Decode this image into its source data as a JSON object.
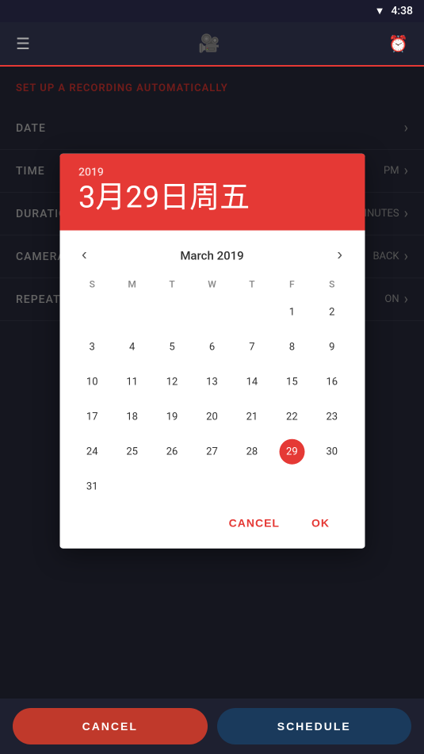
{
  "statusBar": {
    "time": "4:38"
  },
  "topNav": {
    "menuIcon": "☰",
    "cameraIcon": "📹",
    "alarmIcon": "⏰"
  },
  "page": {
    "title": "SET UP A RECORDING AUTOMATICALLY"
  },
  "settings": [
    {
      "label": "DATE",
      "value": "",
      "hasChevron": true
    },
    {
      "label": "TIME",
      "value": "PM",
      "hasChevron": true
    },
    {
      "label": "DURATION",
      "value": "MINUTES",
      "hasChevron": true
    },
    {
      "label": "CAMERA",
      "value": "BACK",
      "hasChevron": true
    },
    {
      "label": "REPEAT",
      "value": "ON",
      "hasChevron": true
    }
  ],
  "dialog": {
    "year": "2019",
    "dateDisplay": "3月29日周五",
    "monthLabel": "March 2019",
    "prevIcon": "‹",
    "nextIcon": "›",
    "dayHeaders": [
      "S",
      "M",
      "T",
      "W",
      "T",
      "F",
      "S"
    ],
    "weeks": [
      [
        "",
        "",
        "",
        "",
        "",
        "1",
        "2"
      ],
      [
        "3",
        "4",
        "5",
        "6",
        "7",
        "8",
        "9"
      ],
      [
        "10",
        "11",
        "12",
        "13",
        "14",
        "15",
        "16"
      ],
      [
        "17",
        "18",
        "19",
        "20",
        "21",
        "22",
        "23"
      ],
      [
        "24",
        "25",
        "26",
        "27",
        "28",
        "29",
        "30"
      ],
      [
        "31",
        "",
        "",
        "",
        "",
        "",
        ""
      ]
    ],
    "selectedDay": "29",
    "cancelLabel": "CANCEL",
    "okLabel": "OK"
  },
  "bottomBar": {
    "cancelLabel": "CANCEL",
    "scheduleLabel": "SCHEDULE"
  }
}
